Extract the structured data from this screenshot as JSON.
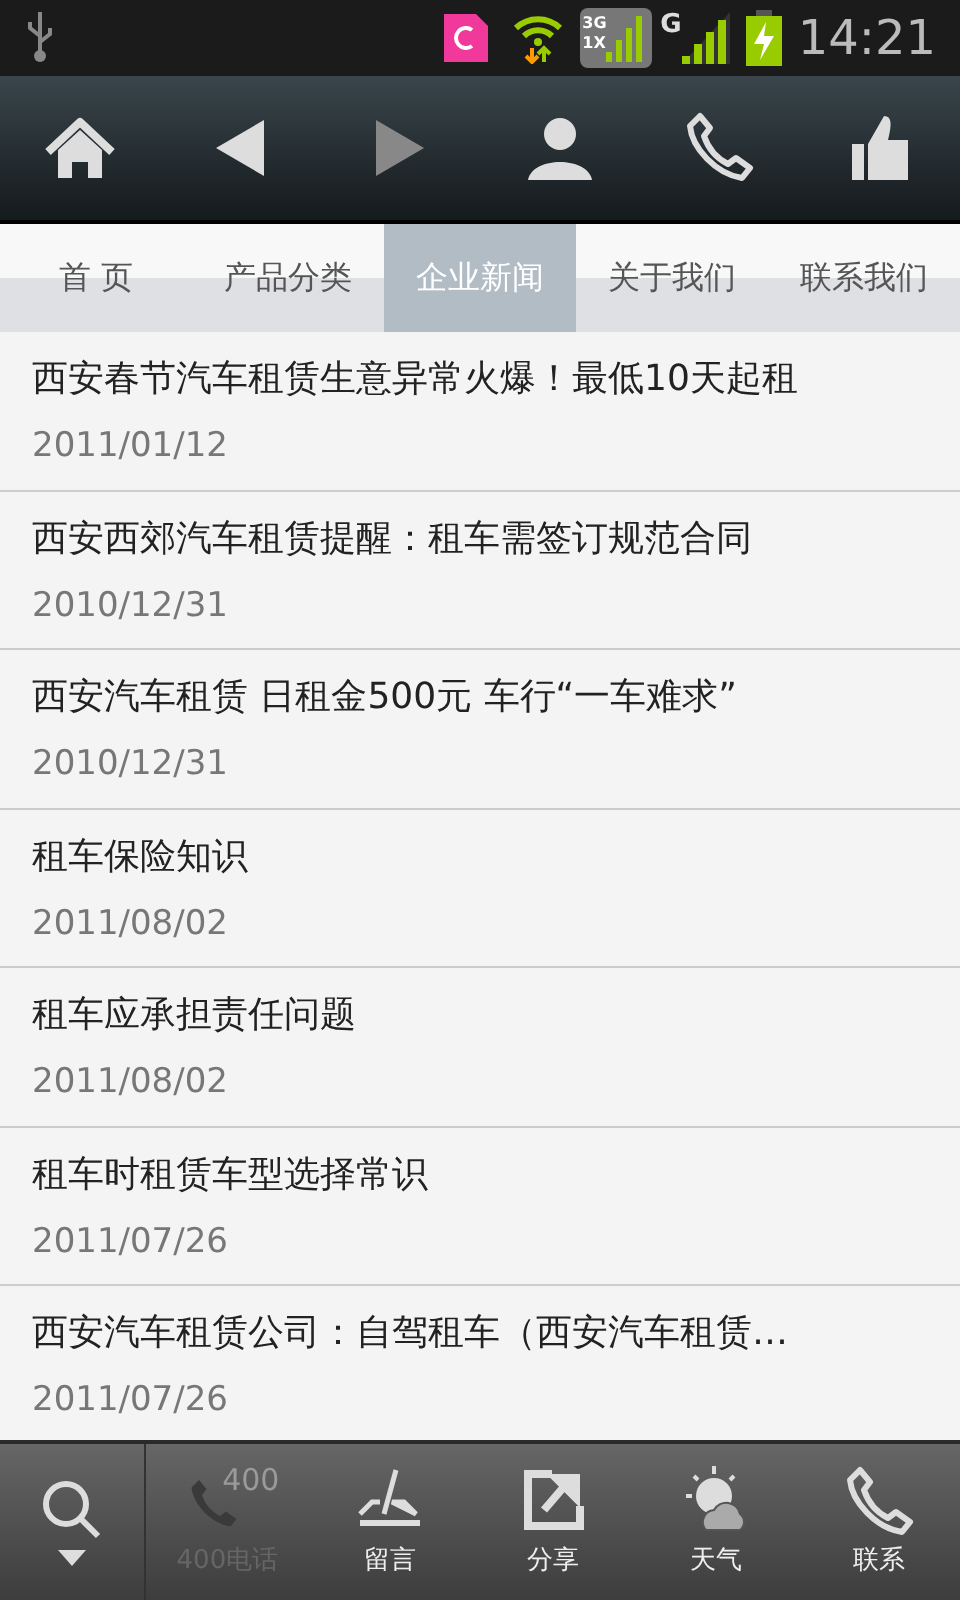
{
  "status_bar": {
    "data_badge": [
      "3G",
      "1X"
    ],
    "network": "G",
    "time": "14:21"
  },
  "toolbar": [
    {
      "kind": "home"
    },
    {
      "kind": "back"
    },
    {
      "kind": "forward"
    },
    {
      "kind": "person"
    },
    {
      "kind": "phone"
    },
    {
      "kind": "thumb"
    }
  ],
  "tabs": [
    {
      "label": "首 页",
      "selected": false
    },
    {
      "label": "产品分类",
      "selected": false
    },
    {
      "label": "企业新闻",
      "selected": true
    },
    {
      "label": "关于我们",
      "selected": false
    },
    {
      "label": "联系我们",
      "selected": false
    }
  ],
  "news": [
    {
      "title": "西安春节汽车租赁生意异常火爆！最低10天起租",
      "date": "2011/01/12"
    },
    {
      "title": "西安西郊汽车租赁提醒：租车需签订规范合同",
      "date": "2010/12/31"
    },
    {
      "title": "西安汽车租赁 日租金500元 车行“一车难求”",
      "date": "2010/12/31"
    },
    {
      "title": "租车保险知识",
      "date": "2011/08/02"
    },
    {
      "title": "租车应承担责任问题",
      "date": "2011/08/02"
    },
    {
      "title": "租车时租赁车型选择常识",
      "date": "2011/07/26"
    },
    {
      "title": "西安汽车租赁公司：自驾租车（西安汽车租赁…",
      "date": "2011/07/26"
    }
  ],
  "bottom_bar": [
    {
      "kind": "phone400",
      "icon_text": "400",
      "label": "400电话",
      "disabled": true
    },
    {
      "kind": "message",
      "label": "留言",
      "disabled": false
    },
    {
      "kind": "share",
      "label": "分享",
      "disabled": false
    },
    {
      "kind": "weather",
      "label": "天气",
      "disabled": false
    },
    {
      "kind": "contact",
      "label": "联系",
      "disabled": false
    }
  ]
}
